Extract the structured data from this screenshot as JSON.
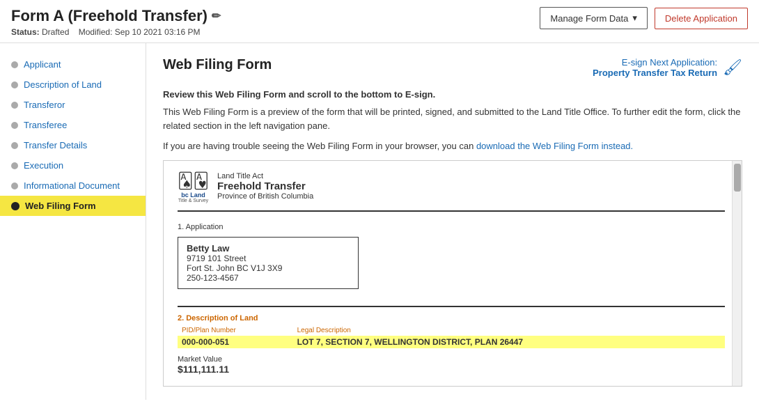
{
  "header": {
    "title": "Form A (Freehold Transfer)",
    "pencil": "✏",
    "status_label": "Status:",
    "status_value": "Drafted",
    "modified_label": "Modified:",
    "modified_value": "Sep 10 2021 03:16 PM",
    "manage_btn": "Manage Form Data",
    "delete_btn": "Delete Application"
  },
  "sidebar": {
    "items": [
      {
        "label": "Applicant",
        "active": false
      },
      {
        "label": "Description of Land",
        "active": false
      },
      {
        "label": "Transferor",
        "active": false
      },
      {
        "label": "Transferee",
        "active": false
      },
      {
        "label": "Transfer Details",
        "active": false
      },
      {
        "label": "Execution",
        "active": false
      },
      {
        "label": "Informational Document",
        "active": false
      },
      {
        "label": "Web Filing Form",
        "active": true
      }
    ]
  },
  "main": {
    "heading": "Web Filing Form",
    "esign_label": "E-sign Next Application:",
    "esign_title": "Property Transfer Tax Return",
    "intro_bold": "Review this Web Filing Form and scroll to the bottom to E-sign.",
    "intro_p1": "This Web Filing Form is a preview of the form that will be printed, signed, and submitted to the Land Title Office. To further edit the form, click the related section in the left navigation pane.",
    "intro_p2_prefix": "If you are having trouble seeing the Web Filing Form in your browser, you can ",
    "intro_p2_link": "download the Web Filing Form instead.",
    "form": {
      "act": "Land Title Act",
      "form_name": "Freehold Transfer",
      "province": "Province of British Columbia",
      "section1": "1. Application",
      "applicant_name": "Betty Law",
      "applicant_addr1": "9719 101 Street",
      "applicant_addr2": "Fort St. John BC V1J 3X9",
      "applicant_phone": "250-123-4567",
      "section2": "2. Description of Land",
      "col_pid": "PID/Plan Number",
      "col_legal": "Legal Description",
      "pid_value": "000-000-051",
      "legal_value": "LOT 7, SECTION 7, WELLINGTON DISTRICT, PLAN 26447",
      "market_value_label": "Market Value",
      "market_value": "$111,111.11"
    }
  }
}
